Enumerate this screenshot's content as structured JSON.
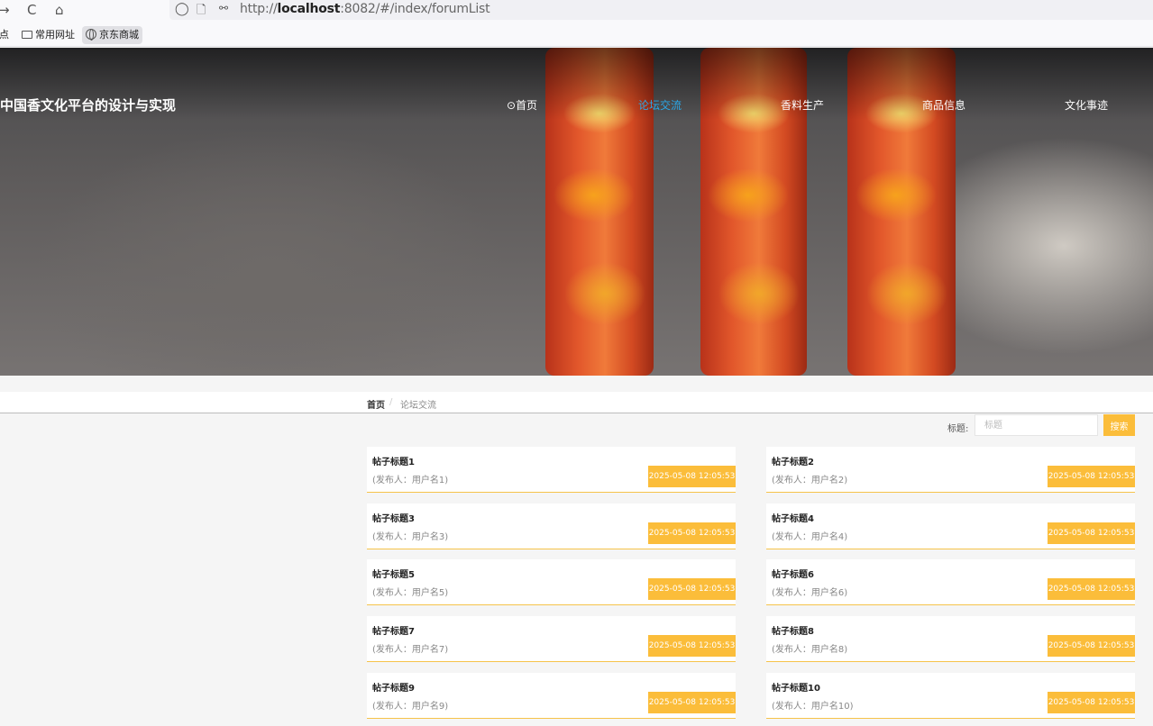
{
  "browser": {
    "url_prefix": "http://",
    "url_host": "localhost",
    "url_rest": ":8082/#/index/forumList",
    "bookmarks": [
      "站点",
      "常用网址",
      "京东商城"
    ]
  },
  "site": {
    "title": "中国香文化平台的设计与实现"
  },
  "nav": [
    {
      "label": "⊙首页"
    },
    {
      "label": "论坛交流"
    },
    {
      "label": "香料生产"
    },
    {
      "label": "商品信息"
    },
    {
      "label": "文化事迹"
    }
  ],
  "breadcrumb": {
    "home": "首页",
    "separator": "/",
    "current": "论坛交流"
  },
  "search": {
    "label": "标题:",
    "placeholder": "标题",
    "button": "搜索"
  },
  "posts": [
    {
      "title": "帖子标题1",
      "author": "(发布人：用户名1)",
      "time": "2025-05-08 12:05:53"
    },
    {
      "title": "帖子标题2",
      "author": "(发布人：用户名2)",
      "time": "2025-05-08 12:05:53"
    },
    {
      "title": "帖子标题3",
      "author": "(发布人：用户名3)",
      "time": "2025-05-08 12:05:53"
    },
    {
      "title": "帖子标题4",
      "author": "(发布人：用户名4)",
      "time": "2025-05-08 12:05:53"
    },
    {
      "title": "帖子标题5",
      "author": "(发布人：用户名5)",
      "time": "2025-05-08 12:05:53"
    },
    {
      "title": "帖子标题6",
      "author": "(发布人：用户名6)",
      "time": "2025-05-08 12:05:53"
    },
    {
      "title": "帖子标题7",
      "author": "(发布人：用户名7)",
      "time": "2025-05-08 12:05:53"
    },
    {
      "title": "帖子标题8",
      "author": "(发布人：用户名8)",
      "time": "2025-05-08 12:05:53"
    },
    {
      "title": "帖子标题9",
      "author": "(发布人：用户名9)",
      "time": "2025-05-08 12:05:53"
    },
    {
      "title": "帖子标题10",
      "author": "(发布人：用户名10)",
      "time": "2025-05-08 12:05:53"
    }
  ],
  "colors": {
    "accent": "#fbbd3a",
    "nav_active": "#2aa8e8"
  }
}
